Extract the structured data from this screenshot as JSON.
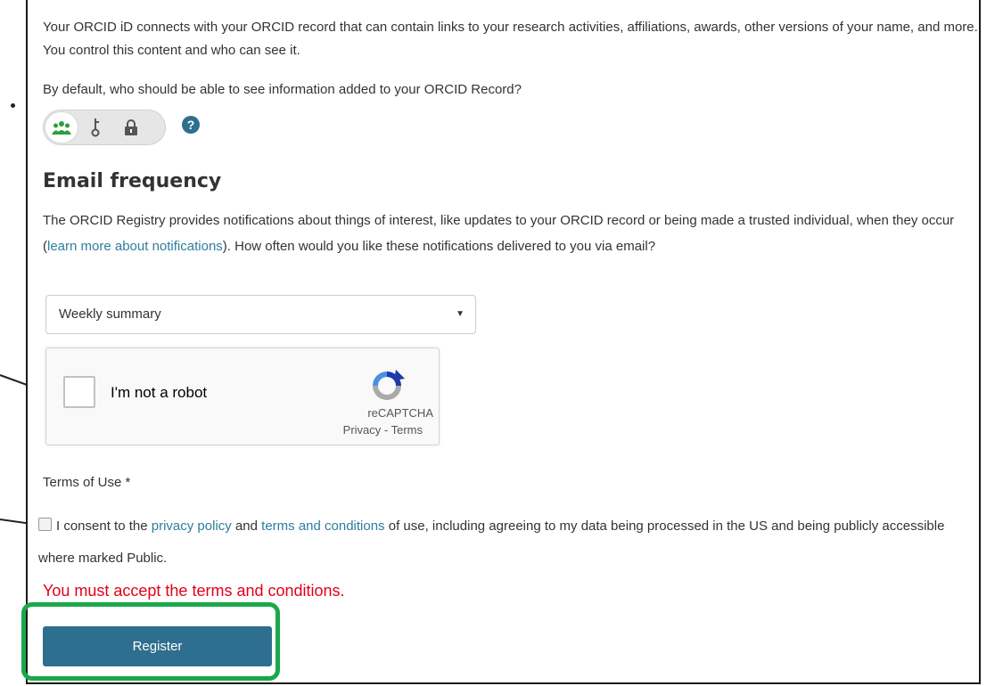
{
  "intro": {
    "text": "Your ORCID iD connects with your ORCID record that can contain links to your research activities, affiliations, awards, other versions of your name, and more. You control this content and who can see it."
  },
  "visibility": {
    "question": "By default, who should be able to see information added to your ORCID Record?",
    "options": [
      {
        "icon": "everyone-icon",
        "selected": true
      },
      {
        "icon": "key-icon",
        "selected": false
      },
      {
        "icon": "lock-icon",
        "selected": false
      }
    ],
    "help_symbol": "?"
  },
  "email_frequency": {
    "heading": "Email frequency",
    "text_before": "The ORCID Registry provides notifications about things of interest, like updates to your ORCID record or being made a trusted individual, when they occur (",
    "link_text": "learn more about notifications",
    "text_after": "). How often would you like these notifications delivered to you via email?",
    "selected": "Weekly summary"
  },
  "captcha": {
    "label": "I'm not a robot",
    "brand": "reCAPTCHA",
    "footer": "Privacy - Terms"
  },
  "terms": {
    "label": "Terms of Use *",
    "consent_pre": "I consent to the ",
    "privacy_link": "privacy policy",
    "and": " and ",
    "terms_link": "terms and conditions",
    "consent_post": " of use, including agreeing to my data being processed in the US and being publicly accessible where marked Public.",
    "error": "You must accept the terms and conditions."
  },
  "register": {
    "label": "Register"
  },
  "colors": {
    "accent": "#2e6e8e",
    "link": "#2e7d9e",
    "error": "#e2001a",
    "highlight": "#19a84a",
    "everyone_icon": "#2e9e3a"
  }
}
